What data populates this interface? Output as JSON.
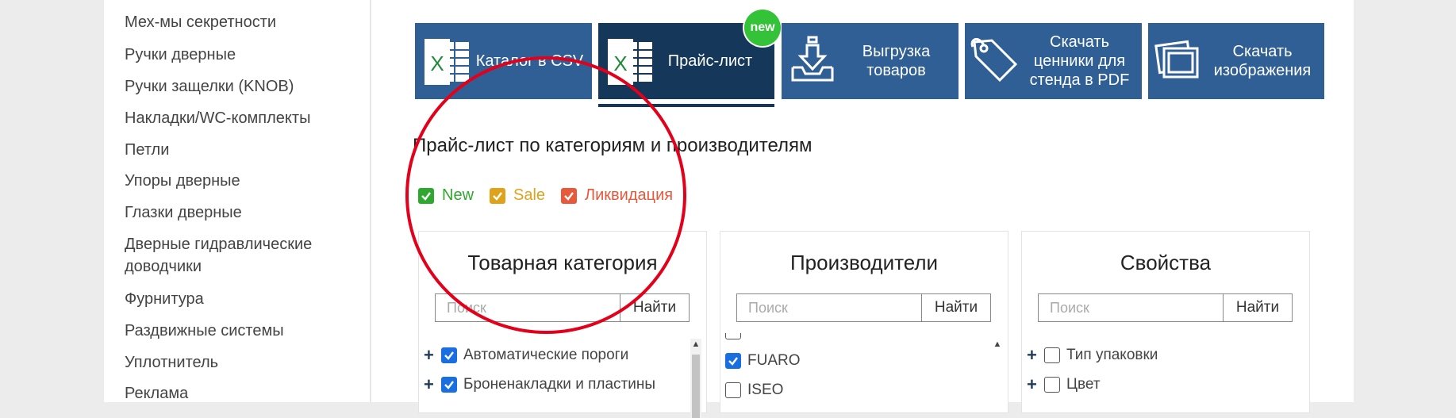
{
  "sidebar": {
    "items": [
      "Мех-мы секретности",
      "Ручки дверные",
      "Ручки защелки (KNOB)",
      "Накладки/WC-комплекты",
      "Петли",
      "Упоры дверные",
      "Глазки дверные",
      "Дверные гидравлические доводчики",
      "Фурнитура",
      "Раздвижные системы",
      "Уплотнитель",
      "Реклама"
    ]
  },
  "tabs": [
    {
      "label": "Каталог в CSV",
      "icon": "excel-icon"
    },
    {
      "label": "Прайс-лист",
      "icon": "excel-icon",
      "active": true,
      "badge": "new"
    },
    {
      "label": "Выгрузка товаров",
      "icon": "download-tray-icon"
    },
    {
      "label": "Скачать ценники для стенда в PDF",
      "icon": "price-tag-icon"
    },
    {
      "label": "Скачать изображения",
      "icon": "images-icon"
    }
  ],
  "section_title": "Прайс-лист по категориям и производителям",
  "legend": [
    {
      "label": "New",
      "color": "#2fa82f"
    },
    {
      "label": "Sale",
      "color": "#e0a21a"
    },
    {
      "label": "Ликвидация",
      "color": "#e8583a"
    }
  ],
  "panels": [
    {
      "title": "Товарная категория",
      "search_placeholder": "Поиск",
      "button": "Найти",
      "items": [
        {
          "label": "Автоматические пороги",
          "checked": true,
          "expandable": true
        },
        {
          "label": "Броненакладки и пластины",
          "checked": true,
          "expandable": true
        }
      ]
    },
    {
      "title": "Производители",
      "search_placeholder": "Поиск",
      "button": "Найти",
      "items": [
        {
          "label": "FUARO",
          "checked": true,
          "expandable": false
        },
        {
          "label": "ISEO",
          "checked": false,
          "expandable": false
        }
      ]
    },
    {
      "title": "Свойства",
      "search_placeholder": "Поиск",
      "button": "Найти",
      "items": [
        {
          "label": "Тип упаковки",
          "checked": false,
          "expandable": true
        },
        {
          "label": "Цвет",
          "checked": false,
          "expandable": true
        }
      ]
    }
  ],
  "colors": {
    "tab": "#2f5f95",
    "tab_active": "#14375a",
    "badge": "#34c238",
    "annotation": "#e2001a",
    "checkbox_checked": "#1a6fe0"
  }
}
